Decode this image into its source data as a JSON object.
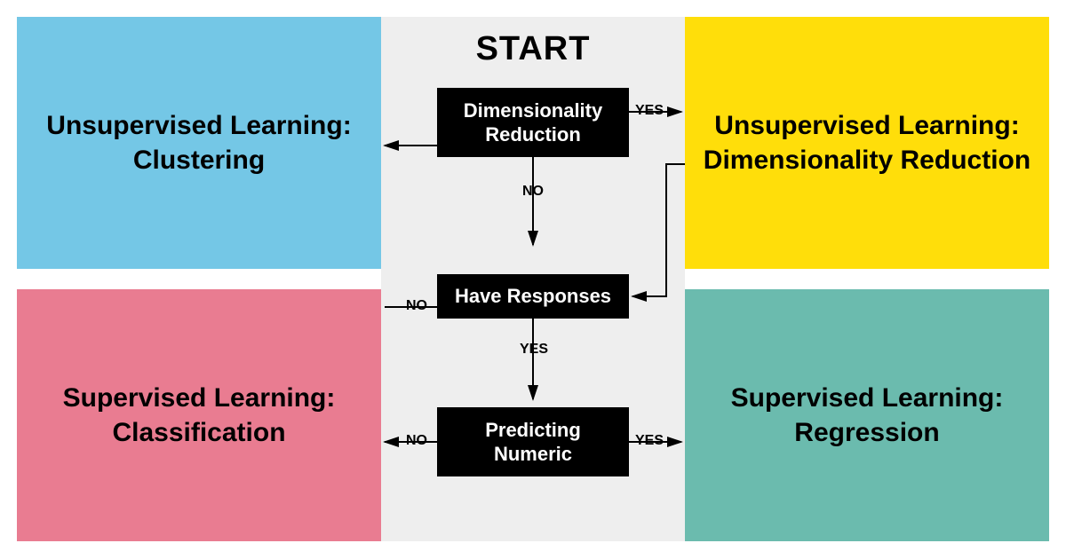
{
  "title": "START",
  "quadrants": {
    "top_left": "Unsupervised Learning:\nClustering",
    "top_right": "Unsupervised Learning:\nDimensionality Reduction",
    "bottom_left": "Supervised Learning:\nClassification",
    "bottom_right": "Supervised Learning:\nRegression"
  },
  "decisions": {
    "d1": "Dimensionality\nReduction",
    "d2": "Have Responses",
    "d3": "Predicting\nNumeric"
  },
  "labels": {
    "d1_yes": "YES",
    "d1_no": "NO",
    "d2_no": "NO",
    "d2_yes": "YES",
    "d3_no": "NO",
    "d3_yes": "YES"
  },
  "colors": {
    "top_left": "#74C7E6",
    "top_right": "#FFDE0A",
    "bottom_left": "#E97C91",
    "bottom_right": "#6BBBAE",
    "center_bg": "#EEEEEE",
    "decision_bg": "#000000"
  }
}
